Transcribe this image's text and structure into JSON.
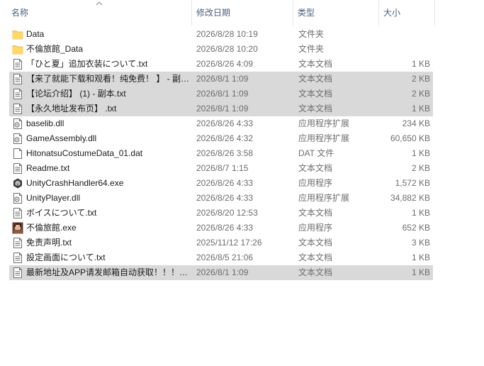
{
  "columns": {
    "name": "名称",
    "date": "修改日期",
    "type": "类型",
    "size": "大小"
  },
  "files": [
    {
      "icon": "folder-icon",
      "name": "Data",
      "date": "2026/8/28 10:19",
      "type": "文件夹",
      "size": "",
      "selected": false
    },
    {
      "icon": "folder-icon",
      "name": "不倫旅館_Data",
      "date": "2026/8/28 10:20",
      "type": "文件夹",
      "size": "",
      "selected": false
    },
    {
      "icon": "text-file-icon",
      "name": "「ひと夏」追加衣装について.txt",
      "date": "2026/8/26 4:09",
      "type": "文本文档",
      "size": "1 KB",
      "selected": false
    },
    {
      "icon": "text-file-icon",
      "name": "【来了就能下载和观看！纯免费！ 】 - 副…",
      "date": "2026/8/1 1:09",
      "type": "文本文档",
      "size": "2 KB",
      "selected": true
    },
    {
      "icon": "text-file-icon",
      "name": "【论坛介绍】 (1) - 副本.txt",
      "date": "2026/8/1 1:09",
      "type": "文本文档",
      "size": "2 KB",
      "selected": true
    },
    {
      "icon": "text-file-icon",
      "name": "【永久地址发布页】 .txt",
      "date": "2026/8/1 1:09",
      "type": "文本文档",
      "size": "1 KB",
      "selected": true
    },
    {
      "icon": "dll-file-icon",
      "name": "baselib.dll",
      "date": "2026/8/26 4:33",
      "type": "应用程序扩展",
      "size": "234 KB",
      "selected": false
    },
    {
      "icon": "dll-file-icon",
      "name": "GameAssembly.dll",
      "date": "2026/8/26 4:32",
      "type": "应用程序扩展",
      "size": "60,650 KB",
      "selected": false
    },
    {
      "icon": "blank-file-icon",
      "name": "HitonatsuCostumeData_01.dat",
      "date": "2026/8/26 3:58",
      "type": "DAT 文件",
      "size": "1 KB",
      "selected": false
    },
    {
      "icon": "text-file-icon",
      "name": "Readme.txt",
      "date": "2026/8/7 1:15",
      "type": "文本文档",
      "size": "2 KB",
      "selected": false
    },
    {
      "icon": "unity-app-icon",
      "name": "UnityCrashHandler64.exe",
      "date": "2026/8/26 4:33",
      "type": "应用程序",
      "size": "1,572 KB",
      "selected": false
    },
    {
      "icon": "dll-file-icon",
      "name": "UnityPlayer.dll",
      "date": "2026/8/26 4:33",
      "type": "应用程序扩展",
      "size": "34,882 KB",
      "selected": false
    },
    {
      "icon": "text-file-icon",
      "name": "ボイスについて.txt",
      "date": "2026/8/20 12:53",
      "type": "文本文档",
      "size": "1 KB",
      "selected": false
    },
    {
      "icon": "game-app-icon",
      "name": "不倫旅館.exe",
      "date": "2026/8/26 4:33",
      "type": "应用程序",
      "size": "652 KB",
      "selected": false
    },
    {
      "icon": "text-file-icon",
      "name": "免责声明.txt",
      "date": "2025/11/12 17:26",
      "type": "文本文档",
      "size": "3 KB",
      "selected": false
    },
    {
      "icon": "text-file-icon",
      "name": "設定画面について.txt",
      "date": "2026/8/5 21:06",
      "type": "文本文档",
      "size": "1 KB",
      "selected": false
    },
    {
      "icon": "text-file-icon",
      "name": "最新地址及APP请发邮箱自动获取！！！…",
      "date": "2026/8/1 1:09",
      "type": "文本文档",
      "size": "1 KB",
      "selected": true
    }
  ]
}
